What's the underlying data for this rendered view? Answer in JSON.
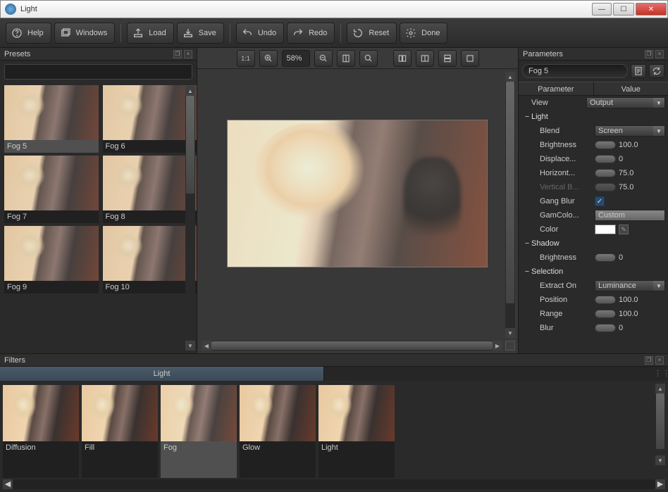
{
  "window": {
    "title": "Light"
  },
  "toolbar": {
    "help": "Help",
    "windows": "Windows",
    "load": "Load",
    "save": "Save",
    "undo": "Undo",
    "redo": "Redo",
    "reset": "Reset",
    "done": "Done"
  },
  "presets": {
    "title": "Presets",
    "items": [
      {
        "label": "Fog 5",
        "selected": true
      },
      {
        "label": "Fog 6"
      },
      {
        "label": "Fog 7"
      },
      {
        "label": "Fog 8"
      },
      {
        "label": "Fog 9"
      },
      {
        "label": "Fog 10"
      }
    ]
  },
  "viewer": {
    "zoom": "58%"
  },
  "parameters": {
    "title": "Parameters",
    "preset_name": "Fog 5",
    "header_param": "Parameter",
    "header_value": "Value",
    "rows": {
      "view_label": "View",
      "view_value": "Output",
      "light_group": "Light",
      "blend_label": "Blend",
      "blend_value": "Screen",
      "brightness_label": "Brightness",
      "brightness_value": "100.0",
      "displace_label": "Displace...",
      "displace_value": "0",
      "horiz_label": "Horizont...",
      "horiz_value": "75.0",
      "vert_label": "Vertical B...",
      "vert_value": "75.0",
      "gangblur_label": "Gang Blur",
      "gamcolor_label": "GamColo...",
      "gamcolor_value": "Custom",
      "color_label": "Color",
      "shadow_group": "Shadow",
      "sbrightness_label": "Brightness",
      "sbrightness_value": "0",
      "selection_group": "Selection",
      "extract_label": "Extract On",
      "extract_value": "Luminance",
      "position_label": "Position",
      "position_value": "100.0",
      "range_label": "Range",
      "range_value": "100.0",
      "blur_label": "Blur",
      "blur_value": "0"
    }
  },
  "filters": {
    "title": "Filters",
    "tab": "Light",
    "items": [
      {
        "label": "Diffusion"
      },
      {
        "label": "Fill"
      },
      {
        "label": "Fog",
        "selected": true
      },
      {
        "label": "Glow"
      },
      {
        "label": "Light"
      }
    ]
  }
}
